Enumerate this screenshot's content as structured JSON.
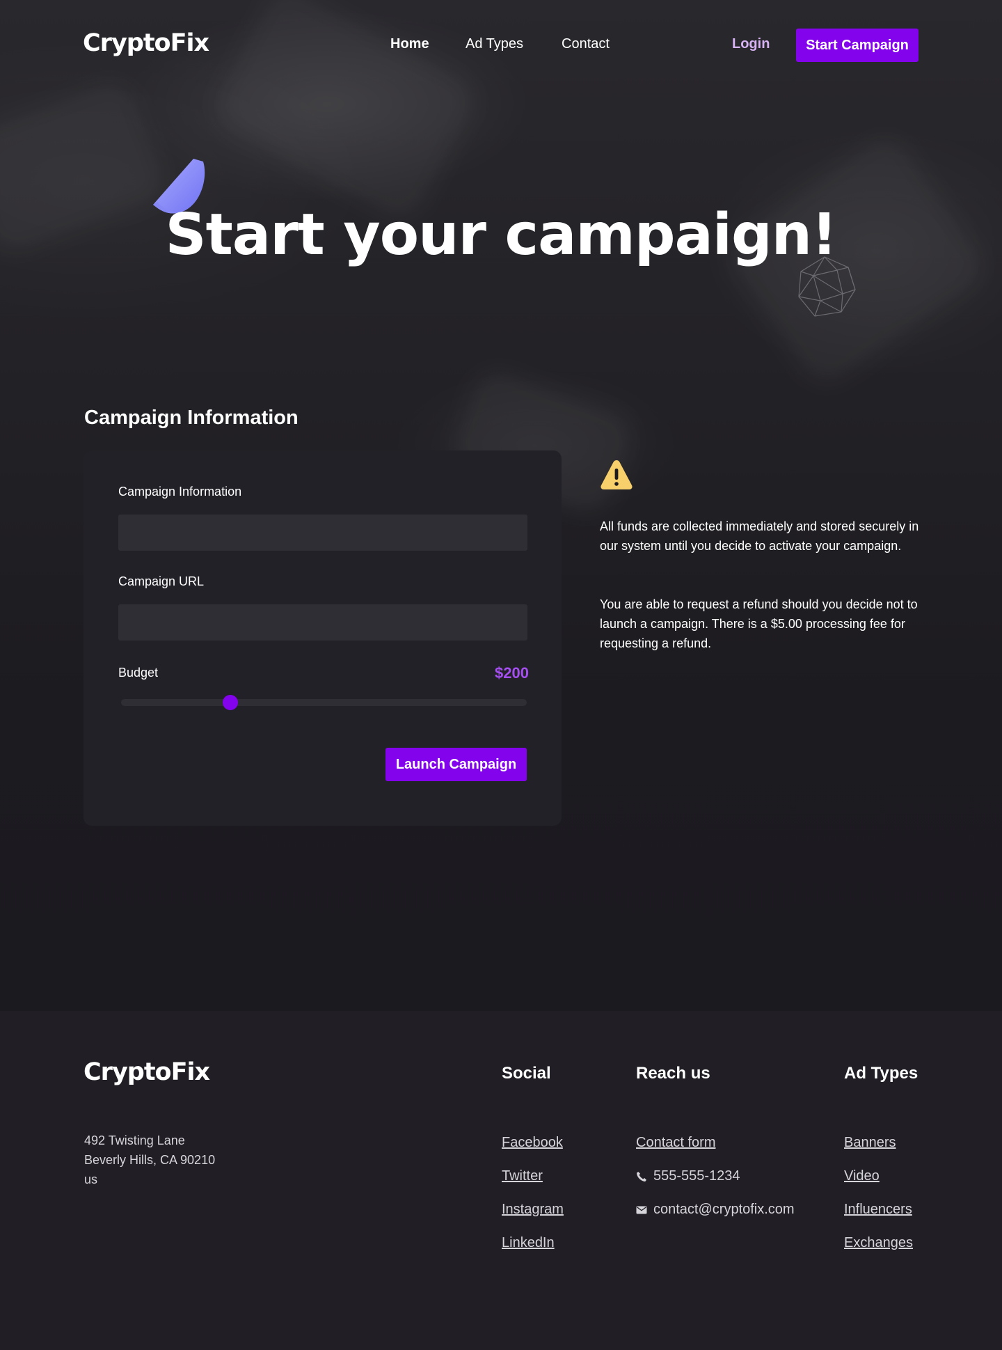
{
  "brand": {
    "name": "CryptoFix"
  },
  "nav": {
    "links": [
      {
        "label": "Home"
      },
      {
        "label": "Ad Types"
      },
      {
        "label": "Contact"
      }
    ],
    "login_label": "Login",
    "cta_label": "Start Campaign"
  },
  "hero": {
    "title": "Start your campaign!"
  },
  "campaign": {
    "section_title": "Campaign Information",
    "name_label": "Campaign Information",
    "name_value": "",
    "url_label": "Campaign URL",
    "url_value": "",
    "budget_label": "Budget",
    "budget_value": "$200",
    "budget_slider_fraction": 0.27,
    "launch_label": "Launch Campaign"
  },
  "notice": {
    "icon": "warning-icon",
    "paragraph_1": "All funds are collected immediately and stored securely in our system until you decide to activate your campaign.",
    "paragraph_2": "You are able to request a refund should you decide not to launch a campaign. There is a $5.00 processing fee for requesting a refund."
  },
  "footer": {
    "brand": "CryptoFix",
    "address": [
      "492 Twisting Lane",
      "Beverly Hills, CA 90210",
      "us"
    ],
    "social": {
      "title": "Social",
      "links": [
        "Facebook",
        "Twitter",
        "Instagram",
        "LinkedIn"
      ]
    },
    "reach": {
      "title": "Reach us",
      "contact_form": "Contact form",
      "phone": "555-555-1234",
      "email": "contact@cryptofix.com"
    },
    "ad_types": {
      "title": "Ad Types",
      "links": [
        "Banners",
        "Video",
        "Influencers",
        "Exchanges"
      ]
    }
  },
  "colors": {
    "accent": "#8303ec",
    "budget_text": "#a54ff0",
    "login_text": "#d7b3f3",
    "warning": "#f7cf6b",
    "background": "#1b1a1f",
    "card": "#232128",
    "input": "#302e35",
    "footer": "#211f25"
  }
}
